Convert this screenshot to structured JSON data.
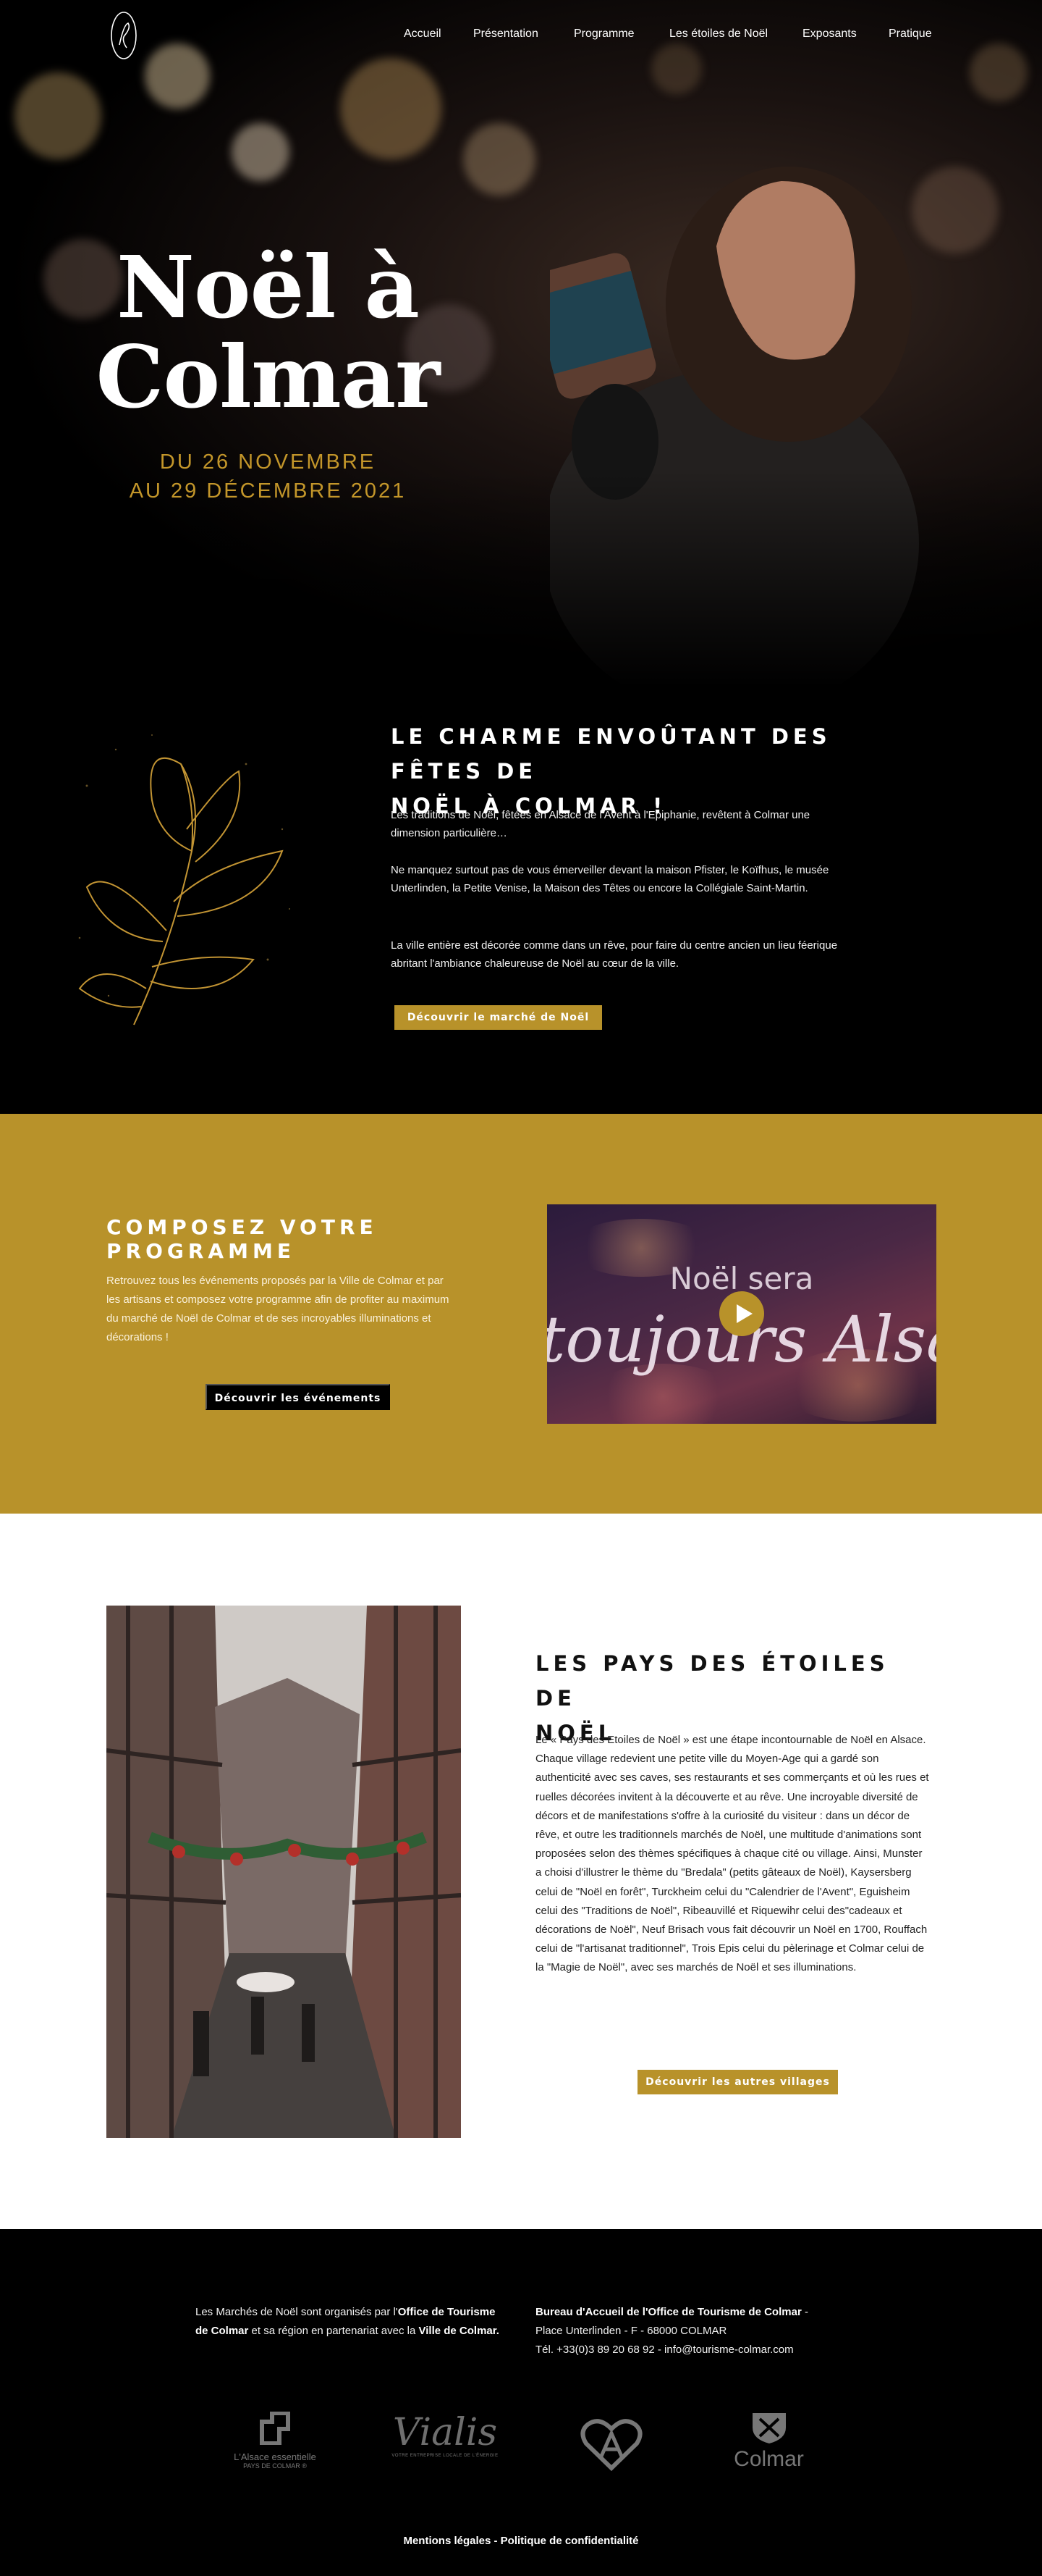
{
  "nav": {
    "items": [
      "Accueil",
      "Présentation",
      "Programme",
      "Les étoiles de Noël",
      "Exposants",
      "Pratique"
    ]
  },
  "hero": {
    "title_line1": "Noël à",
    "title_line2": "Colmar",
    "date_line1": "DU 26 NOVEMBRE",
    "date_line2": "AU 29 DÉCEMBRE 2021"
  },
  "charme": {
    "title_line1": "LE CHARME ENVOÛTANT DES FÊTES DE",
    "title_line2": "NOËL À COLMAR !",
    "p1": "Les traditions de Noël, fêtées en Alsace de l'Avent à l'Epiphanie, revêtent à Colmar une dimension particulière…",
    "p2": "Ne manquez surtout pas de vous émerveiller devant la maison Pfister, le Koïfhus, le musée Unterlinden, la Petite Venise, la Maison des Têtes ou encore la Collégiale Saint-Martin.",
    "p3": "La ville entière est décorée comme dans un rêve, pour faire du centre ancien un lieu féerique abritant l'ambiance chaleureuse de Noël au cœur de la ville.",
    "button": "Découvrir le marché de Noël"
  },
  "programme": {
    "title": "COMPOSEZ VOTRE PROGRAMME",
    "text": "Retrouvez tous les événements proposés par la Ville de Colmar et par les artisans et composez votre programme afin de profiter au maximum du marché de Noël de Colmar et de ses incroyables illuminations et décorations !",
    "button": "Découvrir les événements",
    "video_line1": "Noël sera",
    "video_line2": "toujours Alsacien"
  },
  "etoiles": {
    "title_line1": "LES PAYS DES ÉTOILES DE",
    "title_line2": "NOËL",
    "text1": "Le « Pays des Etoiles de Noël » est une étape incontournable de Noël en Alsace.",
    "text2": "Chaque village redevient une petite ville du Moyen-Age qui a gardé son authenticité avec ses caves, ses restaurants et ses commerçants et où les rues et ruelles décorées invitent à la découverte et au rêve. Une incroyable diversité de décors et de manifestations s'offre à la curiosité du visiteur : dans un décor de rêve, et outre les traditionnels marchés de Noël, une multitude d'animations sont proposées selon des thèmes spécifiques à chaque cité ou village. Ainsi, Munster a choisi d'illustrer le thème du \"Bredala\" (petits gâteaux de Noël), Kaysersberg celui de \"Noël en forêt\", Turckheim celui du \"Calendrier de l'Avent\", Eguisheim celui des \"Traditions de Noël\", Ribeauvillé et Riquewihr celui des\"cadeaux et décorations de Noël\", Neuf Brisach vous fait découvrir un Noël en 1700, Rouffach celui de \"l'artisanat traditionnel\", Trois Epis celui du pèlerinage et Colmar celui de la \"Magie de Noël\", avec ses marchés de Noël et ses illuminations.",
    "button": "Découvrir les autres villages"
  },
  "footer": {
    "left_a": "Les Marchés de Noël sont organisés par l'",
    "left_b": "Office de Tourisme de Colmar",
    "left_c": " et sa région en partenariat avec la ",
    "left_d": "Ville de Colmar.",
    "right_title": "Bureau d'Accueil de l'Office de Tourisme de Colmar",
    "right_dash": " -",
    "right_addr": "Place Unterlinden - F - 68000 COLMAR",
    "right_contact": "Tél. +33(0)3 89 20 68 92 - info@tourisme-colmar.com",
    "partner1_line1": "L'Alsace essentielle",
    "partner1_line2": "PAYS DE COLMAR ®",
    "partner2": "Vialis",
    "partner2_sub": "VOTRE ENTREPRISE LOCALE DE L'ÉNERGIE",
    "partner4": "Colmar",
    "legal1": "Mentions légales",
    "legal_sep": " - ",
    "legal2": "Politique de confidentialité"
  },
  "colors": {
    "gold": "#b8922a",
    "black": "#000000",
    "white": "#ffffff"
  }
}
